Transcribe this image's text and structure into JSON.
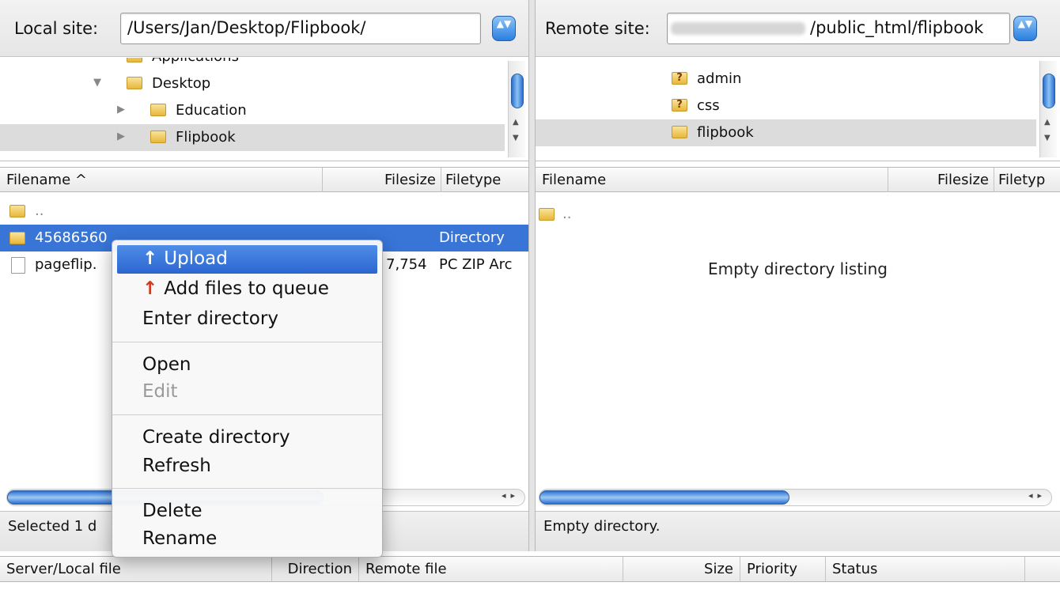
{
  "local": {
    "site_label": "Local site:",
    "path": "/Users/Jan/Desktop/Flipbook/",
    "combo_arrows": "▲▼",
    "tree": [
      {
        "label": "Applications",
        "expanded": null
      },
      {
        "label": "Desktop",
        "expanded": true
      },
      {
        "label": "Education",
        "expanded": false
      },
      {
        "label": "Flipbook",
        "expanded": false,
        "selected": true
      }
    ],
    "columns": {
      "filename": "Filename ^",
      "filesize": "Filesize",
      "filetype": "Filetype"
    },
    "files": [
      {
        "name": "..",
        "size": "",
        "type": "",
        "kind": "folder"
      },
      {
        "name": "45686560",
        "size": "",
        "type": "Directory",
        "kind": "folder",
        "selected": true
      },
      {
        "name": "pageflip.",
        "size": "7,754",
        "type": "PC ZIP Arc",
        "kind": "file"
      }
    ],
    "status": "Selected 1 d"
  },
  "remote": {
    "site_label": "Remote site:",
    "path": "/public_html/flipbook",
    "tree": [
      {
        "label": "admin",
        "icon": "question-folder"
      },
      {
        "label": "css",
        "icon": "question-folder"
      },
      {
        "label": "flipbook",
        "icon": "folder",
        "selected": true
      }
    ],
    "columns": {
      "filename": "Filename",
      "filesize": "Filesize",
      "filetype": "Filetyp"
    },
    "files": [
      {
        "name": "..",
        "kind": "folder"
      }
    ],
    "empty_message": "Empty directory listing",
    "status": "Empty directory."
  },
  "queue": {
    "columns": {
      "server_local": "Server/Local file",
      "direction": "Direction",
      "remote": "Remote file",
      "size": "Size",
      "priority": "Priority",
      "status": "Status"
    }
  },
  "context_menu": {
    "upload": "Upload",
    "add_to_queue": "Add files to queue",
    "enter_directory": "Enter directory",
    "open": "Open",
    "edit": "Edit",
    "create_directory": "Create directory",
    "refresh": "Refresh",
    "delete": "Delete",
    "rename": "Rename",
    "upload_icon": "↑"
  },
  "colors": {
    "selection": "#3875d7",
    "menu_highlight": "#2a66cf",
    "upload_arrow": "#d23a20"
  }
}
